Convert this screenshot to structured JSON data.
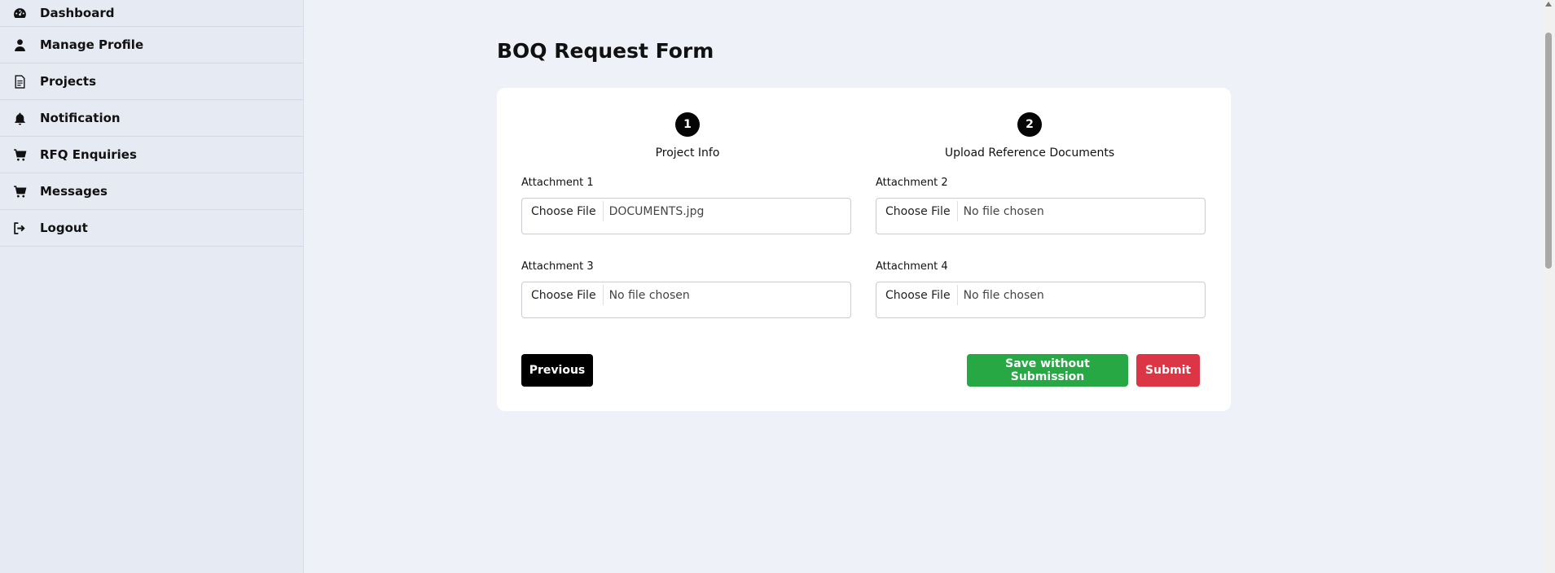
{
  "sidebar": {
    "items": [
      {
        "label": "Dashboard",
        "icon": "dashboard-icon"
      },
      {
        "label": "Manage Profile",
        "icon": "user-icon"
      },
      {
        "label": "Projects",
        "icon": "document-icon"
      },
      {
        "label": "Notification",
        "icon": "bell-icon"
      },
      {
        "label": "RFQ Enquiries",
        "icon": "cart-icon"
      },
      {
        "label": "Messages",
        "icon": "cart-icon"
      },
      {
        "label": "Logout",
        "icon": "logout-icon"
      }
    ]
  },
  "page": {
    "title": "BOQ Request Form"
  },
  "steps": [
    {
      "number": "1",
      "label": "Project Info"
    },
    {
      "number": "2",
      "label": "Upload Reference Documents"
    }
  ],
  "attachments": [
    {
      "label": "Attachment 1",
      "button": "Choose File",
      "file": "DOCUMENTS.jpg"
    },
    {
      "label": "Attachment 2",
      "button": "Choose File",
      "file": "No file chosen"
    },
    {
      "label": "Attachment 3",
      "button": "Choose File",
      "file": "No file chosen"
    },
    {
      "label": "Attachment 4",
      "button": "Choose File",
      "file": "No file chosen"
    }
  ],
  "actions": {
    "previous": "Previous",
    "save": "Save without Submission",
    "submit": "Submit"
  },
  "colors": {
    "background": "#eef1f8",
    "sidebar": "#e6eaf3",
    "primary_black": "#000000",
    "save_green": "#28a745",
    "submit_red": "#dc3545"
  }
}
